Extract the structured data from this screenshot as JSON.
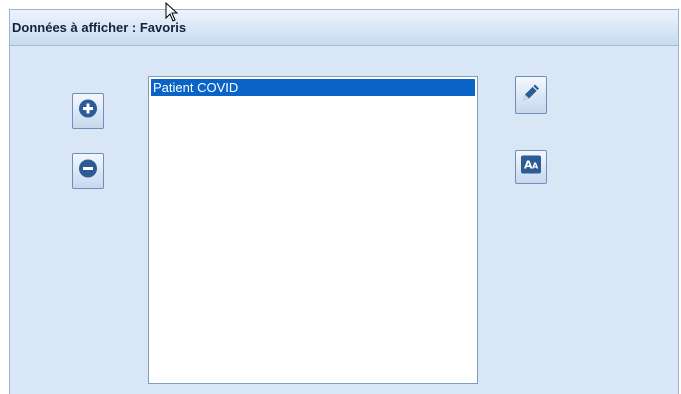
{
  "panel": {
    "title": "Données à afficher : Favoris"
  },
  "list": {
    "items": [
      {
        "label": "Patient COVID",
        "selected": true
      }
    ]
  },
  "toolbar": {
    "add_icon": "plus-circle-icon",
    "remove_icon": "minus-circle-icon",
    "edit_icon": "pencil-icon",
    "font_icon": "font-size-icon",
    "font_icon_text": "AA"
  },
  "colors": {
    "panel_bg": "#d9e6f6",
    "selection": "#0a64c8",
    "icon_blue": "#2b5c95"
  }
}
